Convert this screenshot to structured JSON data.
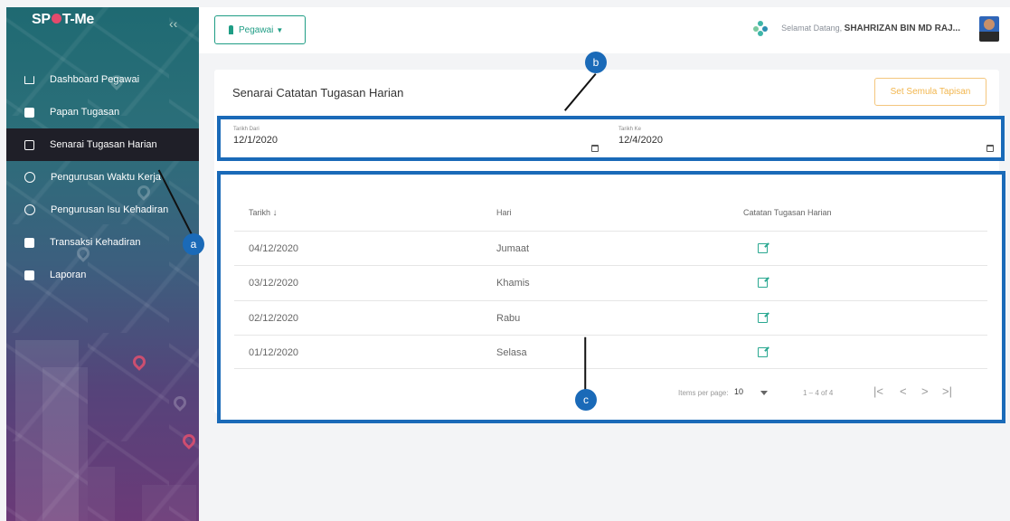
{
  "app": {
    "logo_text_1": "SP",
    "logo_text_2": "T-Me",
    "collapse_icon": "double-chevron-left-icon"
  },
  "sidebar": {
    "items": [
      {
        "label": "Dashboard Pegawai",
        "icon": "home-icon",
        "active": false
      },
      {
        "label": "Papan Tugasan",
        "icon": "puzzle-icon",
        "active": false
      },
      {
        "label": "Senarai Tugasan Harian",
        "icon": "edit-list-icon",
        "active": true
      },
      {
        "label": "Pengurusan Waktu Kerja",
        "icon": "clock-history-icon",
        "active": false
      },
      {
        "label": "Pengurusan Isu Kehadiran",
        "icon": "user-icon",
        "active": false
      },
      {
        "label": "Transaksi Kehadiran",
        "icon": "list-icon",
        "active": false
      },
      {
        "label": "Laporan",
        "icon": "report-icon",
        "active": false
      }
    ]
  },
  "topbar": {
    "role_label": "Pegawai",
    "welcome_prefix": "Selamat Datang,",
    "user_name": "SHAHRIZAN BIN MD RAJ..."
  },
  "main": {
    "page_title": "Senarai Catatan Tugasan Harian",
    "reset_button": "Set Semula Tapisan",
    "filters": {
      "from_label": "Tarikh Dari",
      "from_value": "12/1/2020",
      "to_label": "Tarikh Ke",
      "to_value": "12/4/2020"
    },
    "table": {
      "headers": {
        "date": "Tarikh",
        "day": "Hari",
        "notes": "Catatan Tugasan Harian"
      },
      "rows": [
        {
          "date": "04/12/2020",
          "day": "Jumaat"
        },
        {
          "date": "03/12/2020",
          "day": "Khamis"
        },
        {
          "date": "02/12/2020",
          "day": "Rabu"
        },
        {
          "date": "01/12/2020",
          "day": "Selasa"
        }
      ]
    },
    "paginator": {
      "items_per_page_label": "Items per page:",
      "items_per_page": "10",
      "range": "1 – 4 of 4",
      "first": "|<",
      "prev": "<",
      "next": ">",
      "last": ">|"
    }
  },
  "annotations": {
    "a": "a",
    "b": "b",
    "c": "c"
  },
  "colors": {
    "accent": "#1f9d85",
    "highlight_box": "#1a6ab8",
    "reset_border": "#f4c67d",
    "logo_pin": "#e34a6c"
  }
}
